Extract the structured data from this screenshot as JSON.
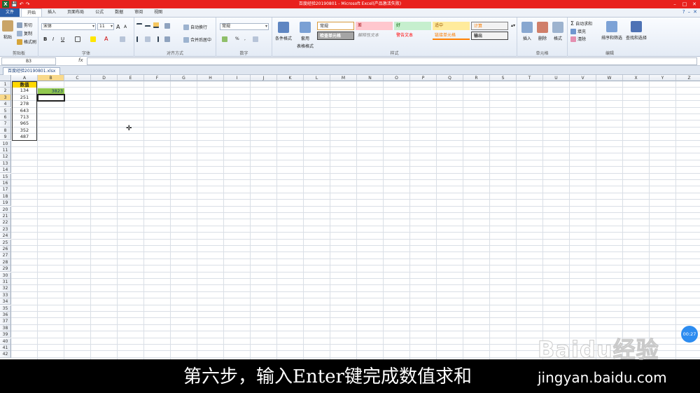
{
  "window": {
    "title": "百度经验20190801 - Microsoft Excel(产品激活失败)"
  },
  "quick_access": {
    "app_icon": "X",
    "save_icon": "💾",
    "undo_icon": "↶",
    "redo_icon": "↷"
  },
  "menu": {
    "file": "文件",
    "tabs": [
      "开始",
      "插入",
      "页面布局",
      "公式",
      "数据",
      "审阅",
      "视图"
    ]
  },
  "ribbon": {
    "clipboard": {
      "label": "剪贴板",
      "paste": "粘贴",
      "cut": "剪切",
      "copy": "复制",
      "format_painter": "格式刷"
    },
    "font": {
      "label": "字体",
      "name": "宋体",
      "size": "11",
      "grow": "A",
      "shrink": "A",
      "bold": "B",
      "italic": "I",
      "underline": "U"
    },
    "alignment": {
      "label": "对齐方式",
      "wrap": "自动换行",
      "merge": "合并后居中"
    },
    "number": {
      "label": "数字",
      "format": "常规",
      "percent": "%",
      "comma": ","
    },
    "styles": {
      "label": "样式",
      "conditional": "条件格式",
      "table": "套用",
      "table2": "表格格式",
      "boxes": [
        "常规",
        "差",
        "好",
        "适中",
        "计算",
        "检查单元格",
        "解释性文本",
        "警告文本",
        "链接单元格",
        "输出"
      ]
    },
    "cells": {
      "label": "单元格",
      "insert": "插入",
      "delete": "删除",
      "format": "格式"
    },
    "editing": {
      "label": "编辑",
      "autosum": "自动求和",
      "fill": "填充",
      "clear": "清除",
      "sort": "排序和筛选",
      "find": "查找和选择"
    }
  },
  "formula_bar": {
    "name_box": "B3",
    "fx": "fx",
    "value": ""
  },
  "workbook_tab": "百度经验20190801.xlsx",
  "sheet": {
    "columns": [
      "A",
      "B",
      "C",
      "D",
      "E",
      "F",
      "G",
      "H",
      "I",
      "J",
      "K",
      "L",
      "M",
      "N",
      "O",
      "P",
      "Q",
      "R",
      "S",
      "T",
      "U",
      "V",
      "W",
      "X",
      "Y",
      "Z"
    ],
    "rows": [
      "1",
      "2",
      "3",
      "4",
      "5",
      "6",
      "7",
      "8",
      "9",
      "10",
      "11",
      "12",
      "13",
      "14",
      "15",
      "16",
      "17",
      "18",
      "19",
      "20",
      "21",
      "22",
      "23",
      "24",
      "25",
      "26",
      "27",
      "28",
      "29",
      "30",
      "31",
      "32",
      "33",
      "34",
      "35",
      "36",
      "37",
      "38",
      "39",
      "40",
      "41",
      "42"
    ],
    "colA": [
      "数值",
      "134",
      "251",
      "278",
      "643",
      "713",
      "965",
      "352",
      "487"
    ],
    "sum_value": "3823",
    "selected_column": "B",
    "selected_row": "3"
  },
  "overlay": {
    "subtitle": "第六步，输入Enter键完成数值求和",
    "site": "jingyan.baidu.com",
    "watermark": "Baidu经验",
    "timer": "00:27"
  },
  "colors": {
    "title_bar": "#e8211d",
    "header_fill": "#ffd800",
    "sum_fill": "#92c94f",
    "timer": "#2d8cf0"
  }
}
